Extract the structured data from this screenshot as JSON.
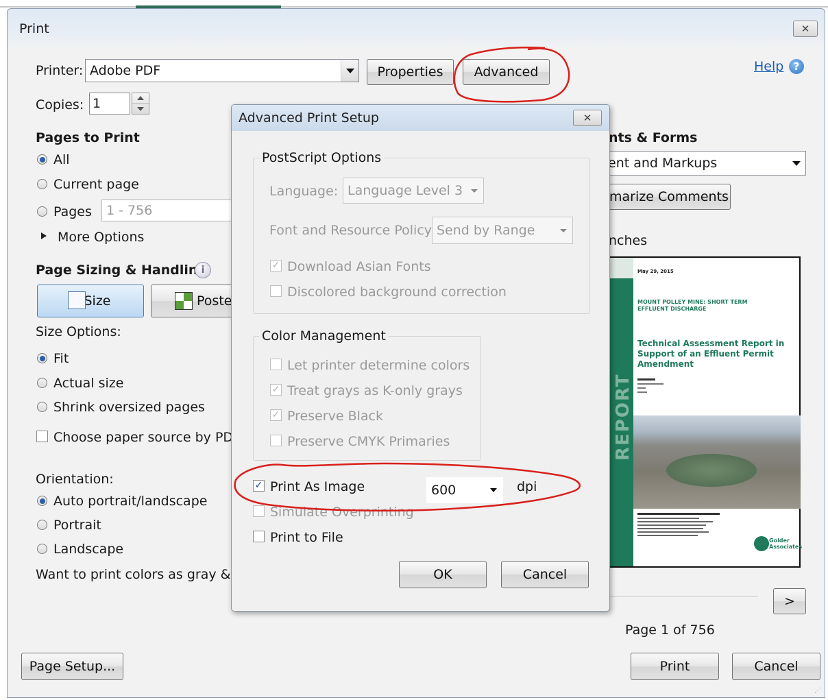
{
  "print": {
    "title": "Print",
    "printer_label": "Printer:",
    "printer_value": "Adobe PDF",
    "properties_label": "Properties",
    "advanced_label": "Advanced",
    "help_label": "Help",
    "copies_label": "Copies:",
    "copies_value": "1",
    "pages_to_print_heading": "Pages to Print",
    "all_label": "All",
    "current_page_label": "Current page",
    "pages_label": "Pages",
    "pages_value": "1 - 756",
    "more_options_label": "More Options",
    "sizing_heading": "Page Sizing & Handling",
    "size_tab_label": "Size",
    "poster_tab_label": "Poste",
    "size_options_label": "Size Options:",
    "fit_label": "Fit",
    "actual_size_label": "Actual size",
    "shrink_label": "Shrink oversized pages",
    "paper_source_label": "Choose paper source by PDF p",
    "orientation_label": "Orientation:",
    "auto_portrait_label": "Auto portrait/landscape",
    "portrait_label": "Portrait",
    "landscape_label": "Landscape",
    "gray_question": "Want to print colors as gray & bla",
    "comments_heading": "nts & Forms",
    "comments_value": "ent and Markups",
    "summarize_label": "marize Comments",
    "units_label": "nches",
    "next_page_label": ">",
    "page_indicator": "Page 1 of 756",
    "page_setup_label": "Page Setup...",
    "print_label": "Print",
    "cancel_label": "Cancel"
  },
  "preview": {
    "date": "May 29, 2015",
    "project_title": "MOUNT POLLEY MINE: SHORT TERM EFFLUENT DISCHARGE",
    "report_title": "Technical Assessment Report in Support of an Effluent Permit Amendment",
    "side_text": "REPORT",
    "logo_text": "Golder Associates"
  },
  "advanced": {
    "title": "Advanced Print Setup",
    "postscript_legend": "PostScript Options",
    "language_label": "Language:",
    "language_value": "Language Level 3",
    "font_policy_label": "Font and Resource Policy:",
    "font_policy_value": "Send by Range",
    "download_asian_fonts": "Download Asian Fonts",
    "discolored_bg": "Discolored background correction",
    "color_mgmt_legend": "Color Management",
    "let_printer_colors": "Let printer determine colors",
    "treat_grays": "Treat grays as K-only grays",
    "preserve_black": "Preserve Black",
    "preserve_cmyk": "Preserve CMYK Primaries",
    "print_as_image": "Print As Image",
    "dpi_value": "600",
    "dpi_unit": "dpi",
    "simulate_overprinting": "Simulate Overprinting",
    "print_to_file": "Print to File",
    "ok_label": "OK",
    "cancel_label": "Cancel"
  },
  "colors": {
    "annotation_red": "#d8201c",
    "link_blue": "#1d5fb8",
    "report_green": "#1e7a5a"
  }
}
